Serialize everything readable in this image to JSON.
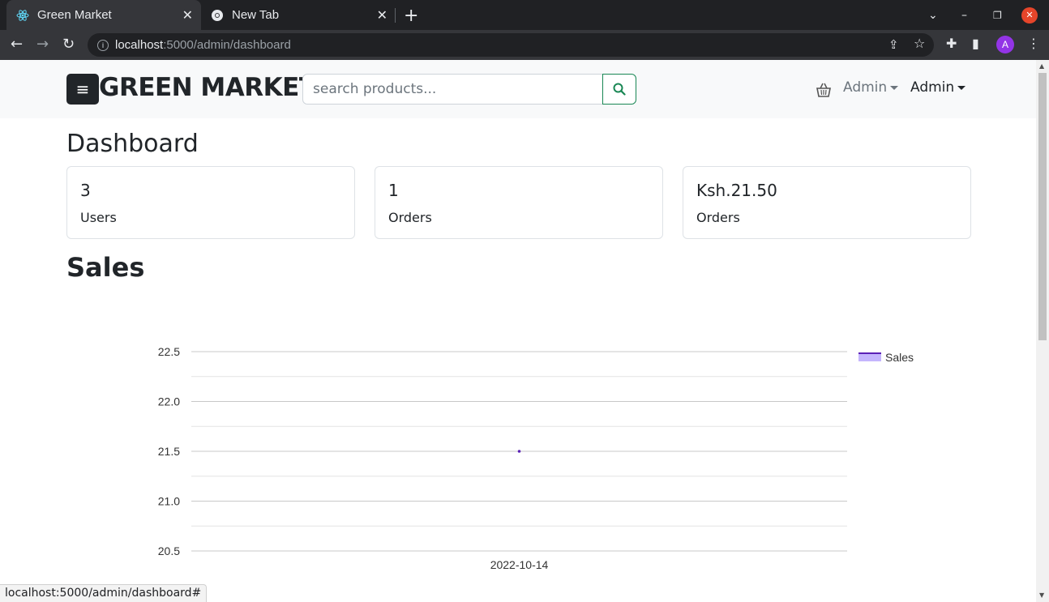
{
  "browser": {
    "tabs": [
      {
        "label": "Green Market",
        "active": true,
        "icon": "react-icon"
      },
      {
        "label": "New Tab",
        "active": false,
        "icon": "chrome-icon"
      }
    ],
    "url_host": "localhost",
    "url_path": ":5000/admin/dashboard",
    "avatar_letter": "A",
    "status_text": "localhost:5000/admin/dashboard#"
  },
  "navbar": {
    "brand": "GREEN MARKET",
    "search_placeholder": "search products...",
    "admin_menu_1": "Admin",
    "admin_menu_2": "Admin"
  },
  "main": {
    "dashboard_title": "Dashboard",
    "cards": [
      {
        "value": "3",
        "label": "Users"
      },
      {
        "value": "1",
        "label": "Orders"
      },
      {
        "value": "Ksh.21.50",
        "label": "Orders"
      }
    ],
    "sales_title": "Sales"
  },
  "colors": {
    "accent_green": "#198754",
    "series_line": "#5b21b6",
    "legend_fill": "#c4b5fd"
  },
  "chart_data": {
    "type": "line",
    "categories": [
      "2022-10-14"
    ],
    "series": [
      {
        "name": "Sales",
        "values": [
          21.5
        ]
      }
    ],
    "ylim": [
      20.5,
      22.5
    ],
    "yticks": [
      "22.5",
      "22.0",
      "21.5",
      "21.0",
      "20.5"
    ],
    "grid": true,
    "legend": "top-right"
  }
}
